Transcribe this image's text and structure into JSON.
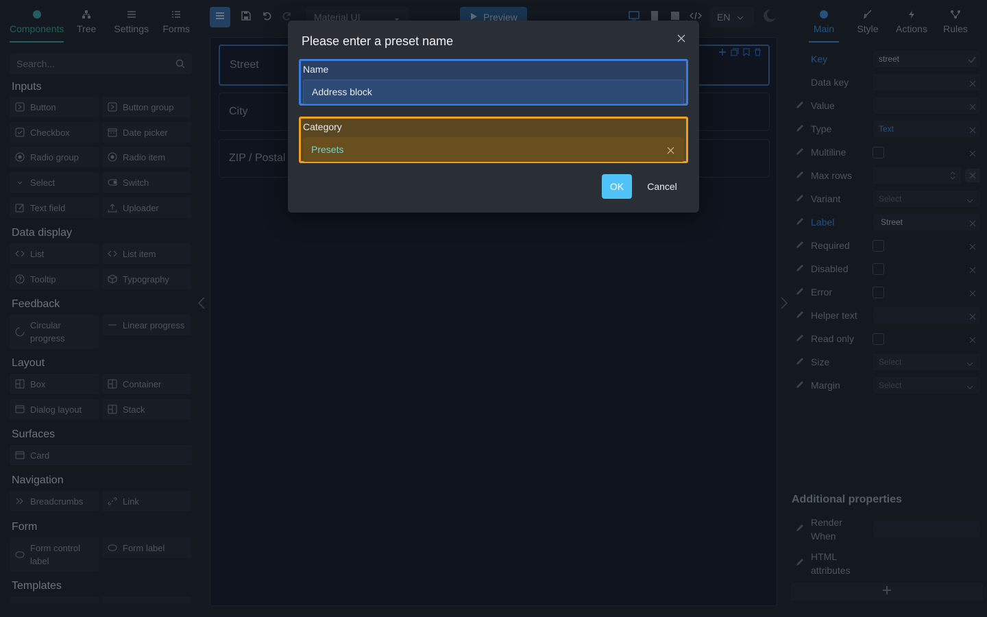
{
  "left_panel": {
    "tabs": [
      {
        "label": "Components",
        "icon": "components-icon",
        "active": true
      },
      {
        "label": "Tree",
        "icon": "tree-icon"
      },
      {
        "label": "Settings",
        "icon": "settings-icon"
      },
      {
        "label": "Forms",
        "icon": "forms-icon"
      }
    ],
    "search_placeholder": "Search...",
    "groups": {
      "inputs": "Inputs",
      "data_display": "Data display",
      "feedback": "Feedback",
      "layout": "Layout",
      "surfaces": "Surfaces",
      "navigation": "Navigation",
      "form": "Form",
      "templates": "Templates"
    },
    "items": {
      "button": "Button",
      "button_group": "Button group",
      "checkbox": "Checkbox",
      "date_picker": "Date picker",
      "radio_group": "Radio group",
      "radio_item": "Radio item",
      "select": "Select",
      "switch": "Switch",
      "text_field": "Text field",
      "uploader": "Uploader",
      "list": "List",
      "list_item": "List item",
      "tooltip": "Tooltip",
      "typography": "Typography",
      "circular_progress": "Circular progress",
      "linear_progress": "Linear progress",
      "box": "Box",
      "container": "Container",
      "dialog_layout": "Dialog layout",
      "stack": "Stack",
      "card": "Card",
      "breadcrumbs": "Breadcrumbs",
      "link": "Link",
      "form_control_label": "Form control label",
      "form_label": "Form label"
    }
  },
  "toolbar": {
    "framework": "Material UI",
    "preview": "Preview",
    "language": "EN"
  },
  "canvas": {
    "fields": [
      "Street",
      "City",
      "ZIP / Postal"
    ]
  },
  "right_panel": {
    "tabs": [
      {
        "label": "Main",
        "active": true
      },
      {
        "label": "Style"
      },
      {
        "label": "Actions"
      },
      {
        "label": "Rules"
      }
    ],
    "props": {
      "key": {
        "label": "Key",
        "value": "street"
      },
      "data_key": {
        "label": "Data key"
      },
      "value": {
        "label": "Value"
      },
      "type": {
        "label": "Type",
        "value": "Text"
      },
      "multiline": {
        "label": "Multiline"
      },
      "max_rows": {
        "label": "Max rows"
      },
      "variant": {
        "label": "Variant",
        "placeholder": "Select"
      },
      "label": {
        "label": "Label",
        "value": "Street"
      },
      "required": {
        "label": "Required"
      },
      "disabled": {
        "label": "Disabled"
      },
      "error": {
        "label": "Error"
      },
      "helper_text": {
        "label": "Helper text"
      },
      "read_only": {
        "label": "Read only"
      },
      "size": {
        "label": "Size",
        "placeholder": "Select"
      },
      "margin": {
        "label": "Margin",
        "placeholder": "Select"
      }
    },
    "additional_title": "Additional properties",
    "render_when": "Render When",
    "html_attributes": "HTML attributes"
  },
  "dialog": {
    "title": "Please enter a preset name",
    "name_label": "Name",
    "name_value": "Address block",
    "category_label": "Category",
    "category_value": "Presets",
    "ok": "OK",
    "cancel": "Cancel"
  },
  "colors": {
    "accent_teal": "#3aa5a2",
    "accent_blue": "#3a8fd6",
    "name_highlight": "#3a7de0",
    "category_highlight": "#f0a020",
    "ok_button": "#4fc3f7"
  }
}
